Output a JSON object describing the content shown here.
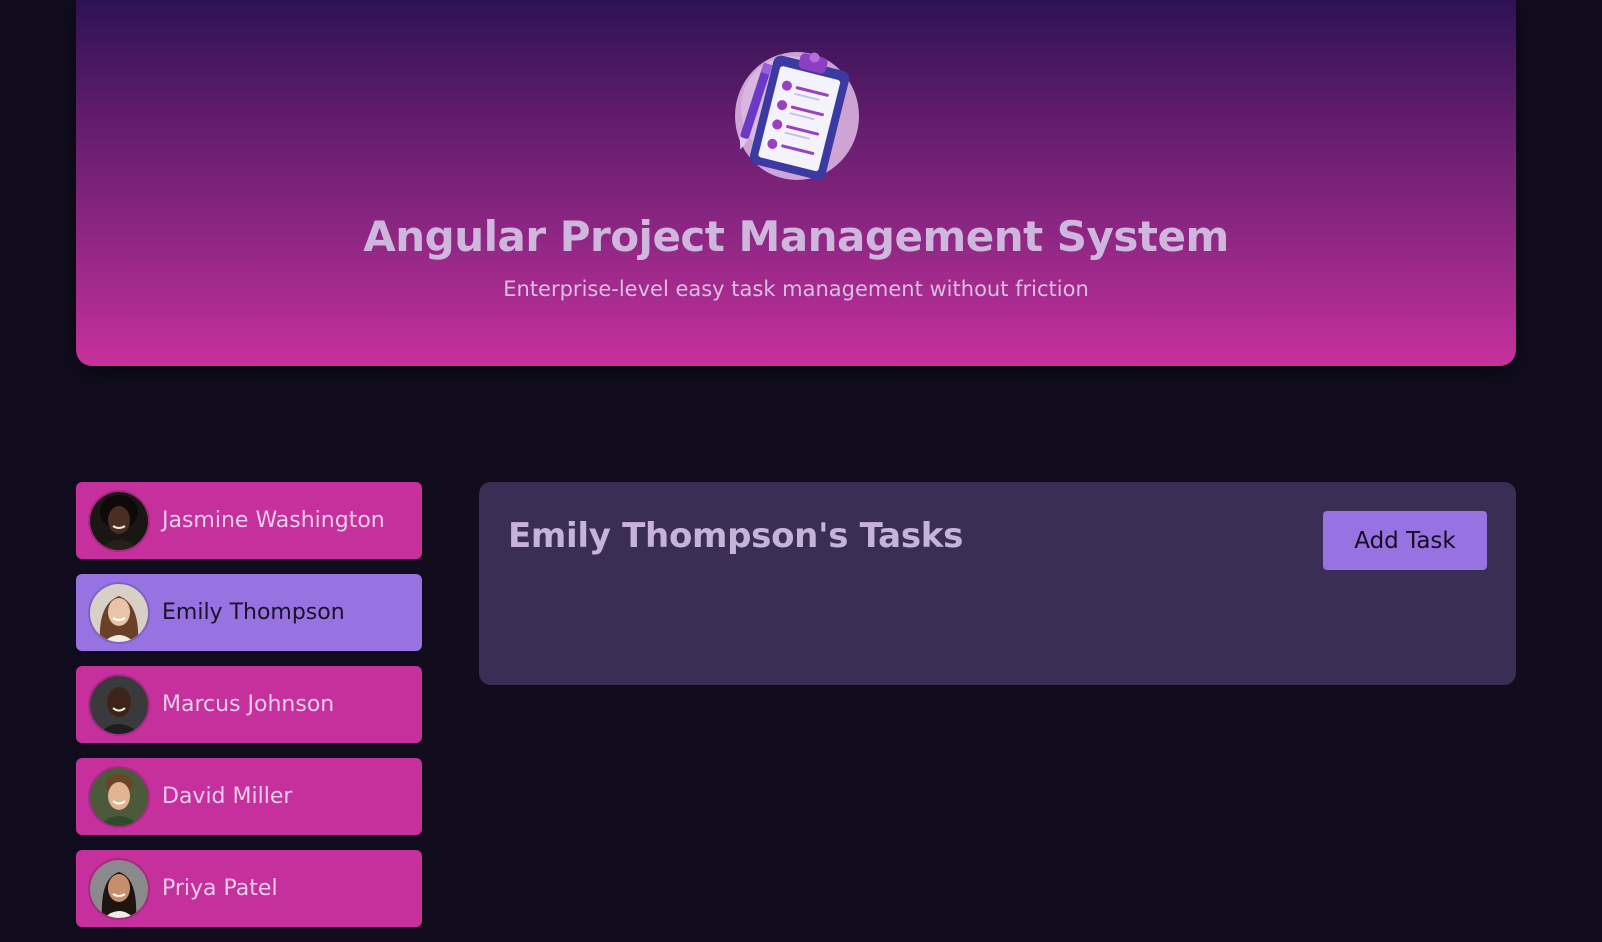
{
  "header": {
    "title": "Angular Project Management System",
    "subtitle": "Enterprise-level easy task management without friction",
    "logo_icon": "clipboard-checklist-icon"
  },
  "users": [
    {
      "name": "Jasmine Washington",
      "selected": false
    },
    {
      "name": "Emily Thompson",
      "selected": true
    },
    {
      "name": "Marcus Johnson",
      "selected": false
    },
    {
      "name": "David Miller",
      "selected": false
    },
    {
      "name": "Priya Patel",
      "selected": false
    }
  ],
  "tasks": {
    "title": "Emily Thompson's Tasks",
    "add_button_label": "Add Task"
  },
  "colors": {
    "background": "#110d1e",
    "user_item": "#c5309c",
    "user_item_selected": "#9673e0",
    "panel": "#3a2e54",
    "accent": "#9673e0"
  }
}
